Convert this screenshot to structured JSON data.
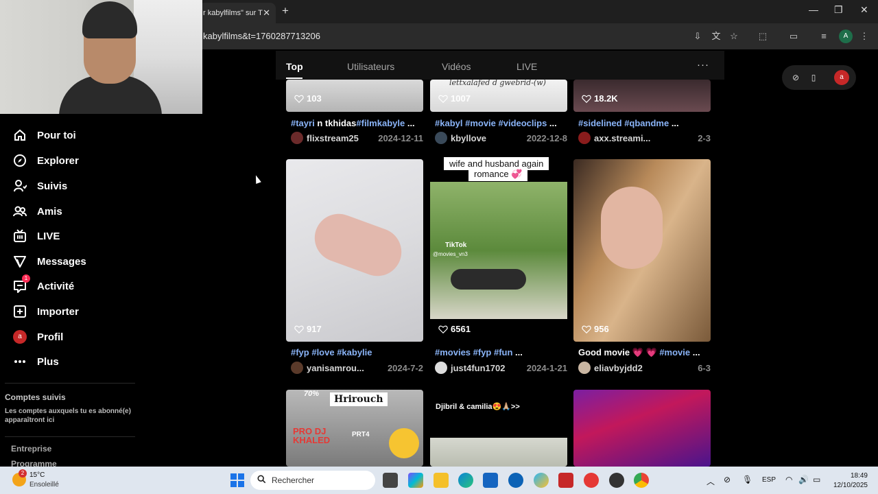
{
  "browser": {
    "tab_title": "r kabylfilms\" sur T",
    "url": "kabylfilms&t=1760287713206"
  },
  "sidebar": {
    "items": [
      {
        "label": "Pour toi",
        "icon": "home-icon"
      },
      {
        "label": "Explorer",
        "icon": "compass-icon"
      },
      {
        "label": "Suivis",
        "icon": "user-follow-icon"
      },
      {
        "label": "Amis",
        "icon": "friends-icon"
      },
      {
        "label": "LIVE",
        "icon": "live-icon"
      },
      {
        "label": "Messages",
        "icon": "send-icon"
      },
      {
        "label": "Activité",
        "icon": "inbox-icon",
        "badge": "1"
      },
      {
        "label": "Importer",
        "icon": "plus-square-icon"
      },
      {
        "label": "Profil",
        "icon": "profile-avatar-icon",
        "avatar_letter": "a"
      },
      {
        "label": "Plus",
        "icon": "more-dots-icon"
      }
    ],
    "followed_title": "Comptes suivis",
    "followed_desc": "Les comptes auxquels tu es abonné(e) apparaîtront ici",
    "footer_links": [
      "Entreprise",
      "Programme"
    ]
  },
  "results": {
    "tabs": [
      "Top",
      "Utilisateurs",
      "Vidéos",
      "LIVE"
    ],
    "active_tab": "Top",
    "floating_avatar": "a"
  },
  "videos": {
    "row1": [
      {
        "likes": "103",
        "caption_parts": [
          [
            "#tayri",
            "tag"
          ],
          [
            " n tkhidas",
            "plain"
          ],
          [
            "#filmkabyle",
            "tag"
          ],
          [
            " ...",
            "plain"
          ]
        ],
        "user": "flixstream25",
        "date": "2024-12-11"
      },
      {
        "likes": "1007",
        "caption_parts": [
          [
            "#kabyl #movie #videoclips",
            "tag"
          ],
          [
            " ...",
            "plain"
          ]
        ],
        "user": "kbyllove",
        "date": "2022-12-8",
        "overlay": "lettxalafed d gwebrid-(w)"
      },
      {
        "likes": "18.2K",
        "caption_parts": [
          [
            "#sidelined #qbandme",
            "tag"
          ],
          [
            " ...",
            "plain"
          ]
        ],
        "user": "axx.streami...",
        "date": "2-3"
      }
    ],
    "row2": [
      {
        "likes": "917",
        "caption_parts": [
          [
            "#fyp #love #kabylie",
            "tag"
          ]
        ],
        "user": "yanisamrou...",
        "date": "2024-7-2"
      },
      {
        "likes": "6561",
        "caption_parts": [
          [
            "#movies #fyp #fun",
            "tag"
          ],
          [
            " ...",
            "plain"
          ]
        ],
        "user": "just4fun1702",
        "date": "2024-1-21",
        "overlay_top": "wife and husband again",
        "overlay_bottom": "romance 💞",
        "watermark": "TikTok",
        "watermark_user": "@movies_vn3"
      },
      {
        "likes": "956",
        "caption_parts": [
          [
            "Good movie 💗 💗 ",
            "plain"
          ],
          [
            "#movie",
            "tag"
          ],
          [
            " ...",
            "plain"
          ]
        ],
        "user": "eliavbyjdd2",
        "date": "6-3"
      }
    ],
    "row3": [
      {
        "overlay": "Hrirouch",
        "overlay2": "PRT4",
        "overlay3": "PRO DJ KHALED",
        "overlay4": "70%"
      },
      {
        "overlay": "Djibril & camilia😍🙏🏼>>"
      },
      {}
    ]
  },
  "taskbar": {
    "weather_badge": "2",
    "temperature": "15°C",
    "condition": "Ensoleillé",
    "search_placeholder": "Rechercher",
    "language": "ESP",
    "time": "18:49",
    "date": "12/10/2025"
  }
}
